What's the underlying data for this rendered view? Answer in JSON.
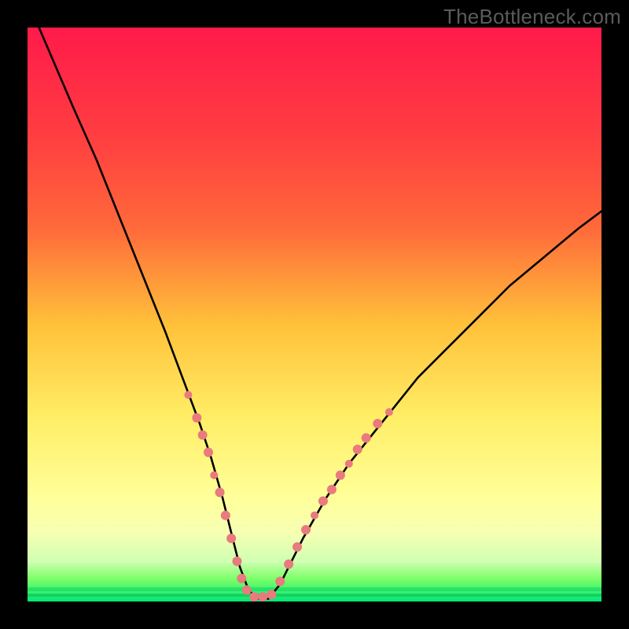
{
  "watermark": "TheBottleneck.com",
  "colors": {
    "bg_black": "#000000",
    "grad_top": "#ff1a4a",
    "grad_mid1": "#ff6a3a",
    "grad_mid2": "#ffc23a",
    "grad_mid3": "#ffee66",
    "grad_soft": "#f6ffb0",
    "grad_green1": "#7fff6a",
    "grad_green2": "#00e874",
    "curve": "#000000",
    "markers": "#e97a7d"
  },
  "chart_data": {
    "type": "line",
    "title": "",
    "xlabel": "",
    "ylabel": "",
    "xlim": [
      0,
      100
    ],
    "ylim": [
      0,
      100
    ],
    "series": [
      {
        "name": "bottleneck-curve",
        "x": [
          2,
          5,
          8,
          12,
          16,
          20,
          24,
          27,
          30,
          32,
          34,
          35.5,
          37,
          38.5,
          40,
          42,
          44,
          48,
          52,
          56,
          60,
          64,
          68,
          72,
          78,
          84,
          90,
          96,
          100
        ],
        "y": [
          100,
          93,
          86,
          77,
          67,
          57,
          47,
          39,
          31,
          25,
          18,
          12,
          6,
          2,
          0.5,
          0.5,
          3,
          11,
          18,
          24,
          29,
          34,
          39,
          43,
          49,
          55,
          60,
          65,
          68
        ]
      }
    ],
    "markers_left": [
      {
        "x": 28.0,
        "y": 36,
        "r": 5
      },
      {
        "x": 29.5,
        "y": 32,
        "r": 6
      },
      {
        "x": 30.5,
        "y": 29,
        "r": 6
      },
      {
        "x": 31.5,
        "y": 26,
        "r": 6
      },
      {
        "x": 32.5,
        "y": 22,
        "r": 5
      },
      {
        "x": 33.5,
        "y": 19,
        "r": 6
      },
      {
        "x": 34.5,
        "y": 15,
        "r": 6
      },
      {
        "x": 35.5,
        "y": 11,
        "r": 6
      },
      {
        "x": 36.5,
        "y": 7,
        "r": 6
      },
      {
        "x": 37.3,
        "y": 4,
        "r": 6
      },
      {
        "x": 38.2,
        "y": 2,
        "r": 6
      }
    ],
    "markers_bottom": [
      {
        "x": 39.5,
        "y": 0.8,
        "r": 6
      },
      {
        "x": 41.0,
        "y": 0.8,
        "r": 6
      },
      {
        "x": 42.5,
        "y": 1.2,
        "r": 6
      }
    ],
    "markers_right": [
      {
        "x": 44.0,
        "y": 3.5,
        "r": 6
      },
      {
        "x": 45.5,
        "y": 6.5,
        "r": 6
      },
      {
        "x": 47.0,
        "y": 9.5,
        "r": 6
      },
      {
        "x": 48.5,
        "y": 12.5,
        "r": 6
      },
      {
        "x": 50.0,
        "y": 15.0,
        "r": 5
      },
      {
        "x": 51.5,
        "y": 17.5,
        "r": 6
      },
      {
        "x": 53.0,
        "y": 19.5,
        "r": 6
      },
      {
        "x": 54.5,
        "y": 22.0,
        "r": 6
      },
      {
        "x": 56.0,
        "y": 24.0,
        "r": 5
      },
      {
        "x": 57.5,
        "y": 26.5,
        "r": 6
      },
      {
        "x": 59.0,
        "y": 28.5,
        "r": 6
      },
      {
        "x": 61.0,
        "y": 31.0,
        "r": 6
      },
      {
        "x": 63.0,
        "y": 33.0,
        "r": 5
      }
    ]
  }
}
